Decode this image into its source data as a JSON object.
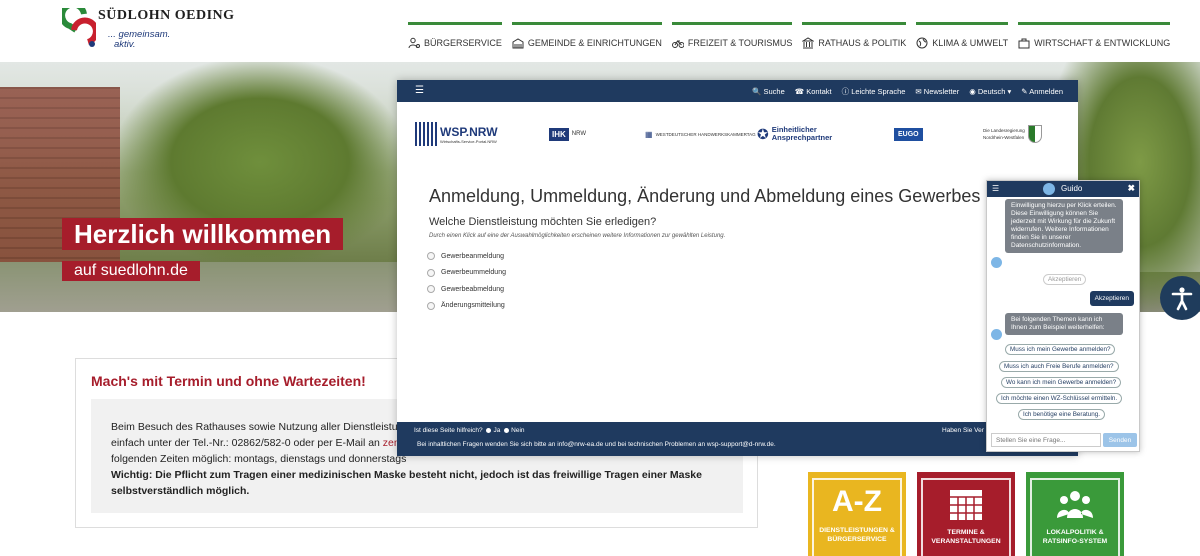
{
  "header": {
    "logo_name": "SÜDLOHN OEDING",
    "claim_line1": "... gemeinsam.",
    "claim_line2": "aktiv.",
    "nav": [
      {
        "label": "BÜRGERSERVICE",
        "icon": "person-gear-icon"
      },
      {
        "label": "GEMEINDE & EINRICHTUNGEN",
        "icon": "buildings-icon"
      },
      {
        "label": "FREIZEIT & TOURISMUS",
        "icon": "bicycle-icon"
      },
      {
        "label": "RATHAUS & POLITIK",
        "icon": "townhall-icon"
      },
      {
        "label": "KLIMA & UMWELT",
        "icon": "globe-icon"
      },
      {
        "label": "WIRTSCHAFT & ENTWICKLUNG",
        "icon": "briefcase-icon"
      }
    ],
    "accent_color": "#3a8a3a"
  },
  "hero": {
    "welcome": "Herzlich willkommen",
    "site": "auf suedlohn.de",
    "banner_color": "#a61d2b"
  },
  "termin": {
    "title": "Mach's mit Termin und ohne Wartezeiten!",
    "line1": "Beim Besuch des Rathauses sowie Nutzung aller Dienstleistunge",
    "line2_a": "einfach unter der Tel.-Nr.: 02862/582-0 oder per E-Mail an ",
    "line2_mail": "zentra",
    "line3": "folgenden Zeiten möglich: montags, dienstags und donnerstags",
    "line4": "Wichtig: Die Pflicht zum Tragen einer medizinischen Maske besteht nicht, jedoch ist das freiwillige Tragen einer Maske",
    "line5": "selbstverständlich möglich."
  },
  "tiles": [
    {
      "label": "DIENSTLEISTUNGEN & BÜRGERSERVICE",
      "big": "A-Z",
      "color": "#e9b620"
    },
    {
      "label": "TERMINE & VERANSTALTUNGEN",
      "icon": "calendar-icon",
      "color": "#a61d2b"
    },
    {
      "label": "LOKALPOLITIK & RATSINFO-SYSTEM",
      "icon": "people-group-icon",
      "color": "#3a9a3a"
    }
  ],
  "wsp": {
    "topbar": {
      "search": "Suche",
      "contact": "Kontakt",
      "easy": "Leichte Sprache",
      "newsletter": "Newsletter",
      "language": "Deutsch",
      "login": "Anmelden"
    },
    "partners": {
      "wsp_name": "WSP.NRW",
      "wsp_sub": "Wirtschafts-Service-Portal.NRW",
      "ihk": "IHK",
      "ihk_sub": "NRW",
      "hwk": "WESTDEUTSCHER HANDWERKSKAMMERTAG",
      "ea1": "Einheitlicher",
      "ea2": "Ansprechpartner",
      "eugo": "EUGO",
      "nrw1": "Die Landesregierung",
      "nrw2": "Nordrhein-Westfalen"
    },
    "title": "Anmeldung, Ummeldung, Änderung und Abmeldung eines Gewerbes",
    "question": "Welche Dienstleistung möchten Sie erledigen?",
    "hint": "Durch einen Klick auf eine der Auswahlmöglichkeiten erscheinen weitere Informationen zur gewählten Leistung.",
    "options": [
      "Gewerbeanmeldung",
      "Gewerbeummeldung",
      "Gewerbeabmeldung",
      "Änderungsmitteilung"
    ],
    "footer": {
      "helpful": "Ist diese Seite hilfreich?",
      "yes": "Ja",
      "no": "Nein",
      "questions": "Haben Sie Ver",
      "contact_line": "Bei inhaltlichen Fragen wenden Sie sich bitte an info@nrw-ea.de und bei technischen Problemen an wsp-support@d-nrw.de."
    },
    "bar_color": "#1f3a5f"
  },
  "chat": {
    "title": "Guido",
    "msg1": "Einwilligung hierzu per Klick erteilen. Diese Einwilligung können Sie jederzeit mit Wirkung für die Zukunft widerrufen. Weitere Informationen finden Sie in unserer Datenschutzinformation.",
    "accept_grey": "Akzeptieren",
    "user_msg": "Akzeptieren",
    "msg2": "Bei folgenden Themen kann ich Ihnen zum Beispiel weiterhelfen:",
    "chips": [
      "Muss ich mein Gewerbe anmelden?",
      "Muss ich auch Freie Berufe anmelden?",
      "Wo kann ich mein Gewerbe anmelden?",
      "Ich möchte einen WZ-Schlüssel ermitteln.",
      "Ich benötige eine Beratung."
    ],
    "input_placeholder": "Stellen Sie eine Frage...",
    "send": "Senden"
  }
}
